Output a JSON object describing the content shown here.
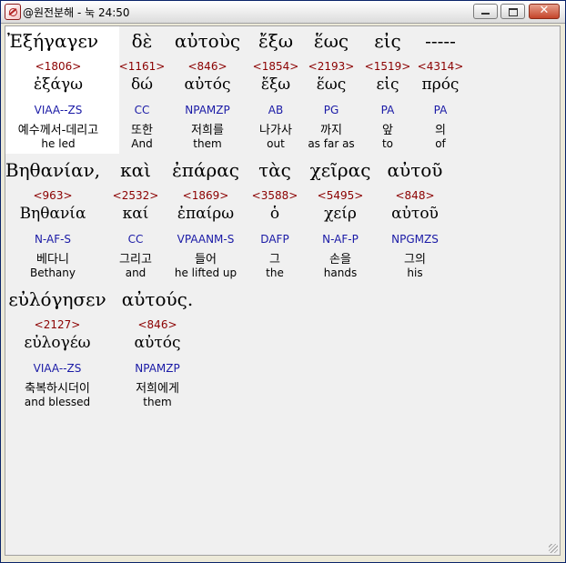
{
  "window": {
    "title": "@원전분해 - 눅 24:50"
  },
  "lines": [
    {
      "words": [
        {
          "greek": "Ἐξήγαγεν",
          "strong": "<1806>",
          "lemma": "ἐξάγω",
          "parse": "VIAA--ZS",
          "korean": "예수께서-데리고",
          "english": "he led"
        },
        {
          "greek": "δὲ",
          "strong": "<1161>",
          "lemma": "δώ",
          "parse": "CC",
          "korean": "또한",
          "english": "And"
        },
        {
          "greek": "αὐτοὺς",
          "strong": "<846>",
          "lemma": "αὐτός",
          "parse": "NPAMZP",
          "korean": "저희를",
          "english": "them"
        },
        {
          "greek": "ἔξω",
          "strong": "<1854>",
          "lemma": "ἔξω",
          "parse": "AB",
          "korean": "나가사",
          "english": "out"
        },
        {
          "greek": "ἕως",
          "strong": "<2193>",
          "lemma": "ἕως",
          "parse": "PG",
          "korean": "까지",
          "english": "as far as"
        },
        {
          "greek": "εἰς",
          "strong": "<1519>",
          "lemma": "εἰς",
          "parse": "PA",
          "korean": "앞",
          "english": "to"
        },
        {
          "greek": "-----",
          "strong": "<4314>",
          "lemma": "πρός",
          "parse": "PA",
          "korean": "의",
          "english": "of"
        }
      ]
    },
    {
      "words": [
        {
          "greek": "Βηθανίαν,",
          "strong": "<963>",
          "lemma": "Βηθανία",
          "parse": "N-AF-S",
          "korean": "베다니",
          "english": "Bethany"
        },
        {
          "greek": "καὶ",
          "strong": "<2532>",
          "lemma": "καί",
          "parse": "CC",
          "korean": "그리고",
          "english": "and"
        },
        {
          "greek": "ἐπάρας",
          "strong": "<1869>",
          "lemma": "ἐπαίρω",
          "parse": "VPAANM-S",
          "korean": "들어",
          "english": "he lifted up"
        },
        {
          "greek": "τὰς",
          "strong": "<3588>",
          "lemma": "ὁ",
          "parse": "DAFP",
          "korean": "그",
          "english": "the"
        },
        {
          "greek": "χεῖρας",
          "strong": "<5495>",
          "lemma": "χείρ",
          "parse": "N-AF-P",
          "korean": "손을",
          "english": "hands"
        },
        {
          "greek": "αὐτοῦ",
          "strong": "<848>",
          "lemma": "αὐτοῦ",
          "parse": "NPGMZS",
          "korean": "그의",
          "english": "his"
        }
      ]
    },
    {
      "words": [
        {
          "greek": "εὐλόγησεν",
          "strong": "<2127>",
          "lemma": "εὐλογέω",
          "parse": "VIAA--ZS",
          "korean": "축복하시더이",
          "english": "and blessed"
        },
        {
          "greek": "αὐτούς.",
          "strong": "<846>",
          "lemma": "αὐτός",
          "parse": "NPAMZP",
          "korean": "저희에게",
          "english": "them"
        }
      ]
    }
  ]
}
